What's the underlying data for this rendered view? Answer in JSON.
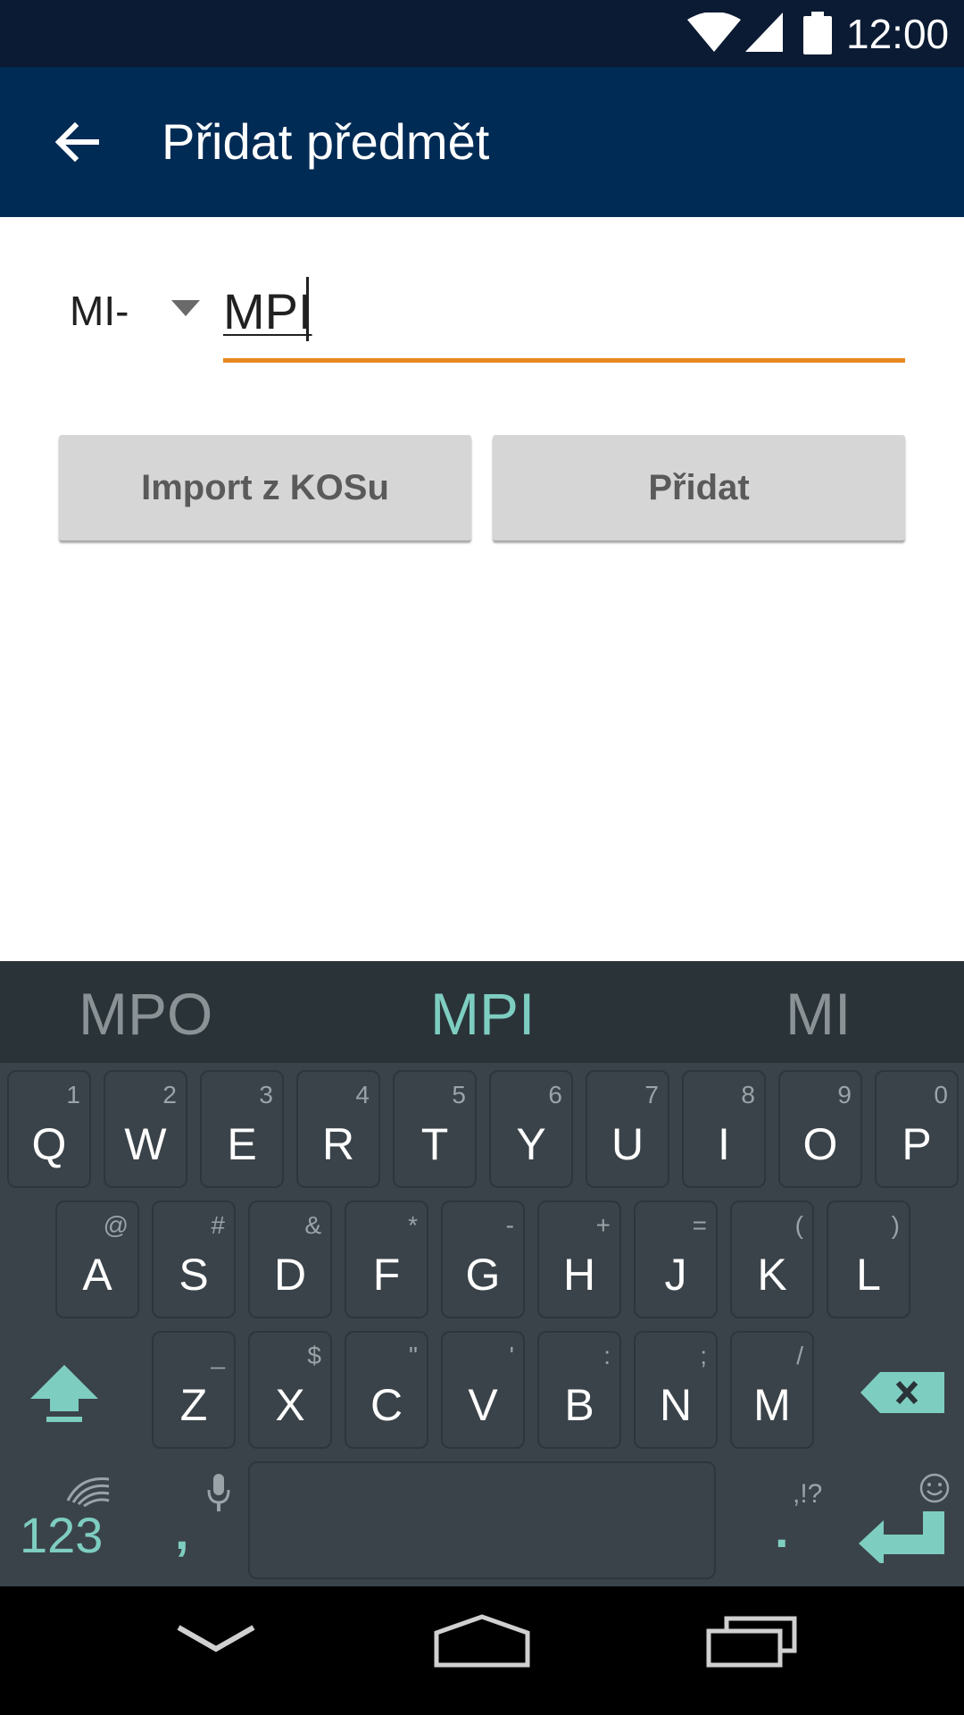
{
  "status_bar": {
    "time": "12:00"
  },
  "app_bar": {
    "title": "Přidat předmět"
  },
  "form": {
    "prefix_value": "MI-",
    "code_value": "MPI",
    "accent_color": "#e8891f"
  },
  "buttons": {
    "import_label": "Import z KOSu",
    "add_label": "Přidat"
  },
  "keyboard": {
    "suggestions": [
      "MPO",
      "MPI",
      "MI"
    ],
    "row1": [
      {
        "key": "Q",
        "hint": "1"
      },
      {
        "key": "W",
        "hint": "2"
      },
      {
        "key": "E",
        "hint": "3"
      },
      {
        "key": "R",
        "hint": "4"
      },
      {
        "key": "T",
        "hint": "5"
      },
      {
        "key": "Y",
        "hint": "6"
      },
      {
        "key": "U",
        "hint": "7"
      },
      {
        "key": "I",
        "hint": "8"
      },
      {
        "key": "O",
        "hint": "9"
      },
      {
        "key": "P",
        "hint": "0"
      }
    ],
    "row2": [
      {
        "key": "A",
        "hint": "@"
      },
      {
        "key": "S",
        "hint": "#"
      },
      {
        "key": "D",
        "hint": "&"
      },
      {
        "key": "F",
        "hint": "*"
      },
      {
        "key": "G",
        "hint": "-"
      },
      {
        "key": "H",
        "hint": "+"
      },
      {
        "key": "J",
        "hint": "="
      },
      {
        "key": "K",
        "hint": "("
      },
      {
        "key": "L",
        "hint": ")"
      }
    ],
    "row3": [
      {
        "key": "Z",
        "hint": "_"
      },
      {
        "key": "X",
        "hint": "$"
      },
      {
        "key": "C",
        "hint": "\""
      },
      {
        "key": "V",
        "hint": "'"
      },
      {
        "key": "B",
        "hint": ":"
      },
      {
        "key": "N",
        "hint": ";"
      },
      {
        "key": "M",
        "hint": "/"
      }
    ],
    "num_label": "123",
    "comma_label": ",",
    "punct_hint": ",!?",
    "period_label": ".",
    "accent_color": "#7ecdc1"
  }
}
